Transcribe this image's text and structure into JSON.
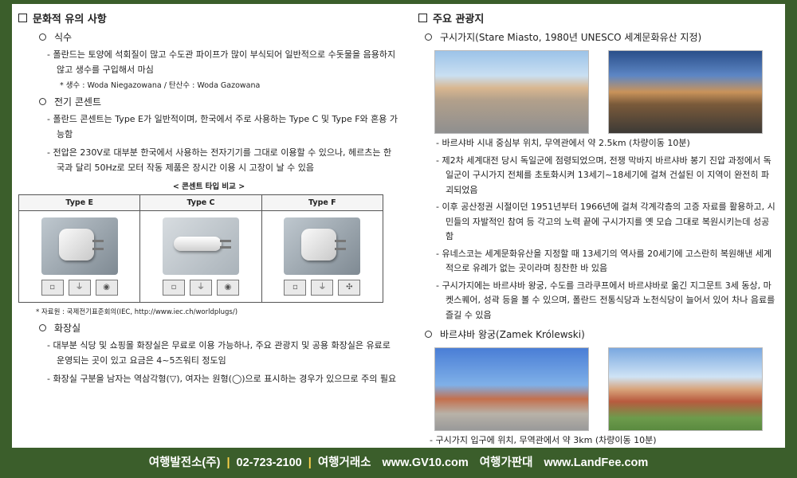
{
  "left": {
    "section_title": "문화적 유의 사항",
    "water": {
      "title": "식수",
      "bullets": [
        "- 폴란드는 토양에 석회질이 많고 수도관 파이프가 많이 부식되어 일반적으로 수돗물을 음용하지 않고 생수를 구입해서 마심"
      ],
      "note": "* 생수 : Woda Niegazowana / 탄산수 : Woda Gazowana"
    },
    "outlet": {
      "title": "전기 콘센트",
      "bullets": [
        "- 폴란드 콘센트는 Type E가 일반적이며, 한국에서 주로 사용하는 Type C 및 Type F와 혼용 가능함",
        "- 전압은 230V로 대부분 한국에서 사용하는 전자기기를 그대로 이용할 수 있으나, 헤르츠는 한국과 달리 50Hz로 모터 작동 제품은 장시간 이용 시 고장이 날 수 있음"
      ],
      "table_caption": "< 콘센트 타입 비교 >",
      "table_headers": [
        "Type E",
        "Type C",
        "Type F"
      ],
      "source": "* 자료원 : 국제전기표준회의(IEC, http://www.iec.ch/worldplugs/)"
    },
    "toilet": {
      "title": "화장실",
      "bullets": [
        "- 대부분 식당 및 쇼핑몰 화장실은 무료로 이용 가능하나, 주요 관광지 및 공용 화장실은 유료로 운영되는 곳이 있고 요금은 4~5즈워티 정도임",
        "- 화장실 구분을 남자는 역삼각형(▽), 여자는 원형(◯)으로 표시하는 경우가 있으므로 주의 필요"
      ]
    }
  },
  "right": {
    "section_title": "주요 관광지",
    "oldtown": {
      "title": "구시가지(Stare Miasto, 1980년 UNESCO 세계문화유산 지정)",
      "bullets": [
        "- 바르샤바 시내 중심부 위치, 무역관에서 약 2.5km (차량이동 10분)",
        "- 제2차 세계대전 당시 독일군에 점령되었으며, 전쟁 막바지 바르샤바 봉기 진압 과정에서 독일군이 구시가지 전체를 초토화시켜 13세기~18세기에 걸쳐 건설된 이 지역이 완전히 파괴되었음",
        "- 이후 공산정권 시절이던 1951년부터 1966년에 걸쳐 각계각층의 고증 자료를 활용하고, 시민들의 자발적인 참여 등 각고의 노력 끝에 구시가지를 옛 모습 그대로 복원시키는데 성공함",
        "- 유네스코는 세계문화유산을 지정할 때 13세기의 역사를 20세기에 고스란히 복원해낸 세계적으로 유례가 없는 곳이라며 칭찬한 바 있음",
        "- 구시가지에는 바르샤바 왕궁, 수도를 크라쿠프에서 바르샤바로 옮긴 지그문트 3세 동상, 마켓스퀘어, 성곽 등을 볼 수 있으며, 폴란드 전통식당과 노천식당이 늘어서 있어 차나 음료를 즐길 수 있음"
      ]
    },
    "castle": {
      "title": "바르샤바 왕궁(Zamek Królewski)",
      "bullets": [
        "- 구시가지 입구에 위치, 무역관에서 약 3km (차량이동 10분)"
      ]
    }
  },
  "footer": {
    "company": "여행발전소(주)",
    "phone": "02-723-2100",
    "label1": "여행거래소",
    "site1": "www.GV10.com",
    "label2": "여행가판대",
    "site2": "www.LandFee.com"
  }
}
